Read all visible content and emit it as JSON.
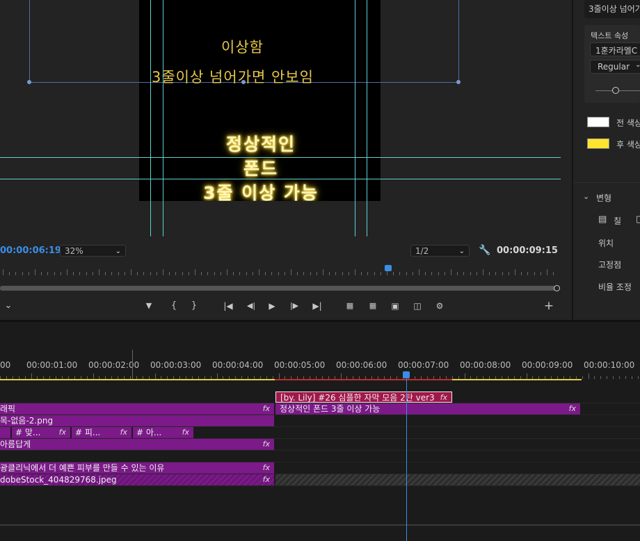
{
  "monitor": {
    "caption_line1": "이상함",
    "caption_line2": "3줄이상 넘어가면 안보임",
    "glow_line1": "정상적인",
    "glow_line2": "폰드",
    "glow_line3": "3줄 이상 가능",
    "current_timecode": "00:00:06:19",
    "zoom": "32%",
    "resolution": "1/2",
    "duration_timecode": "00:00:09:15"
  },
  "panel": {
    "text_preview": "3줄이상 넘어가",
    "text_props_label": "텍스트 속성",
    "font_name": "1훈카라멜C",
    "font_style": "Regular",
    "fill_before_label": "전 색상",
    "fill_after_label": "후 색상",
    "fill_before_color": "#ffffff",
    "fill_after_color": "#ffe42e",
    "transform_label": "변형",
    "fill_label": "칠",
    "position_label": "위치",
    "anchor_label": "고정점",
    "scale_label": "비율 조정"
  },
  "timeline": {
    "time_labels": [
      "00",
      "00:00:01:00",
      "00:00:02:00",
      "00:00:03:00",
      "00:00:04:00",
      "00:00:05:00",
      "00:00:06:00",
      "00:00:07:00",
      "00:00:08:00",
      "00:00:09:00",
      "00:00:10:00"
    ],
    "clips": {
      "nested_title": "[by. Lily] #26 심플한 자막 모음 2탄 ver3",
      "track1_left": "래픽",
      "track1_right": "정상적인 폰드 3줄 이상 가능",
      "track2": "목-없음-2.png",
      "track3_a": "# 맞...",
      "track3_b": "# 피...",
      "track3_c": "# 아...",
      "track4": "아름답게",
      "track5": "광클리닉에서 더 예쁜 피부를 만들 수 있는 이유",
      "track6": "dobeStock_404829768.jpeg",
      "fx": "fx"
    }
  }
}
